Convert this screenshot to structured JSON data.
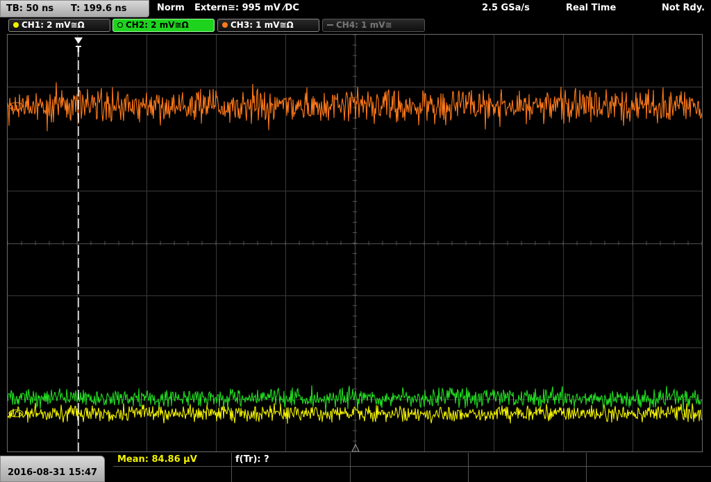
{
  "topbar": {
    "timebase": "TB: 50 ns",
    "trigger_time": "T: 199.6 ns",
    "mode": "Norm",
    "trigger_source": "Extern≅: 995 mV ⁄DC",
    "sample_rate": "2.5 GSa/s",
    "acq_mode": "Real Time",
    "status": "Not Rdy."
  },
  "channels": [
    {
      "label": "CH1: 2 mV≅Ω",
      "color": "#f2f200",
      "state": "on"
    },
    {
      "label": "CH2: 2 mV≅Ω",
      "color": "#22dd22",
      "state": "active"
    },
    {
      "label": "CH3: 1 mV≅Ω",
      "color": "#ff7a1a",
      "state": "on"
    },
    {
      "label": "CH4: 1 mV≅",
      "color": "#777777",
      "state": "off"
    }
  ],
  "screen": {
    "trigger_marker": "T",
    "trace_colors": {
      "ch1": "#f2f200",
      "ch2": "#22dd22",
      "ch3": "#ff7a1a"
    }
  },
  "bottom": {
    "datetime": "2016-08-31 15:47",
    "measurements": {
      "m1": "Mean: 84.86 µV",
      "m2": "f(Tr): ?"
    },
    "mean_color": "#f2f200"
  }
}
